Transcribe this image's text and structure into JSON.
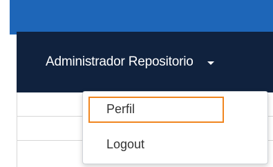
{
  "navbar": {
    "user_menu_label": "Administrador Repositorio",
    "caret_icon": "caret-down-icon"
  },
  "dropdown": {
    "items": [
      {
        "label": "Perfil",
        "highlighted": true
      },
      {
        "label": "Logout",
        "highlighted": false
      }
    ]
  },
  "colors": {
    "top_bar": "#1e66b8",
    "navbar_bg": "#10223e",
    "highlight_border": "#f0851e",
    "menu_text": "#333333"
  }
}
